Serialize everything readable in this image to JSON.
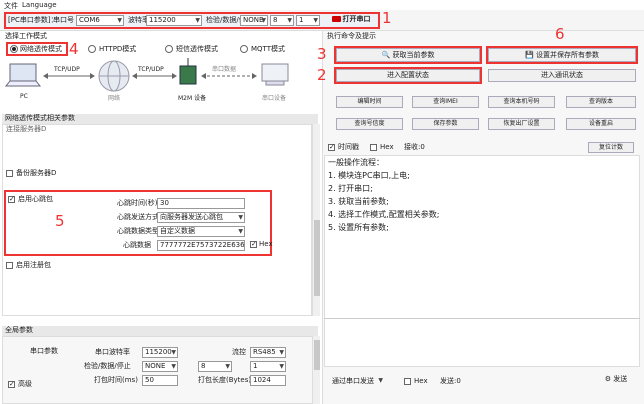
{
  "menu": {
    "file": "文件",
    "language": "Language"
  },
  "serial": {
    "params_label": "[PC串口参数]：",
    "port_label": "串口号",
    "port_value": "COM6",
    "baud_label": "波特率",
    "baud_value": "115200",
    "parity_label": "检验/数据/停止",
    "parity_value": "NONE",
    "data_value": "8",
    "stop_value": "1",
    "open_button": "打开串口"
  },
  "annotations": {
    "n1": "1",
    "n2": "2",
    "n3": "3",
    "n4": "4",
    "n5": "5",
    "n6": "6"
  },
  "work_mode": {
    "header": "选择工作模式",
    "modes": [
      "网络透传模式",
      "HTTPD模式",
      "短信透传模式",
      "MQTT模式"
    ],
    "diagram": {
      "pc": "PC",
      "tcp_udp_1": "TCP/UDP",
      "network": "网络",
      "tcp_udp_2": "TCP/UDP",
      "m2m": "M2M 设备",
      "serial_data": "串口数据",
      "serial_device": "串口设备"
    }
  },
  "net_params": {
    "header": "网络透传模式相关参数",
    "cut_item": "连接服务器D",
    "backup_server": "备份服务器D",
    "heartbeat_enable": "启用心跳包",
    "heartbeat_time_label": "心跳时间(秒)",
    "heartbeat_time_value": "30",
    "heartbeat_mode_label": "心跳发送方式",
    "heartbeat_mode_value": "向服务器发送心跳包",
    "heartbeat_type_label": "心跳数据类型",
    "heartbeat_type_value": "自定义数据",
    "heartbeat_data_label": "心跳数据",
    "heartbeat_data_value": "7777772E7573722E636E",
    "hex_label": "Hex",
    "register_enable": "启用注册包"
  },
  "global": {
    "header": "全局参数",
    "serial_params": "串口参数",
    "baud_label": "串口波特率",
    "baud_value": "115200",
    "flow_label": "流控",
    "flow_value": "RS485",
    "parity_label": "检验/数据/停止",
    "parity_value": "NONE",
    "data_value": "8",
    "stop_value": "1",
    "pack_time_label": "打包时间(ms)",
    "pack_time_value": "50",
    "pack_len_label": "打包长度(Bytes)",
    "pack_len_value": "1024",
    "advanced": "高级"
  },
  "commands": {
    "header": "执行命令及提示",
    "get_params": "获取当前参数",
    "save_all": "设置并保存所有参数",
    "enter_config": "进入配置状态",
    "enter_comm": "进入通讯状态",
    "grid": [
      "编辑时间",
      "查询IMEI",
      "查询本机号码",
      "查询版本",
      "查询号信度",
      "保存参数",
      "恢复出厂设置",
      "设备重启"
    ]
  },
  "log": {
    "time_label": "时间戳",
    "hex_label": "Hex",
    "recv_label": "接收:0",
    "reset_count": "复位计数",
    "lines": [
      "一般操作流程：",
      "1. 模块连PC串口,上电;",
      "2. 打开串口;",
      "3. 获取当前参数;",
      "4. 选择工作模式,配置相关参数;",
      "5. 设置所有参数;"
    ]
  },
  "send": {
    "via_label": "通过串口发送",
    "hex_label": "Hex",
    "sent_label": "发送:0",
    "send_button": "发送"
  },
  "colors": {
    "annotation_red": "#e33",
    "selected_blue": "#cfe0f5"
  }
}
